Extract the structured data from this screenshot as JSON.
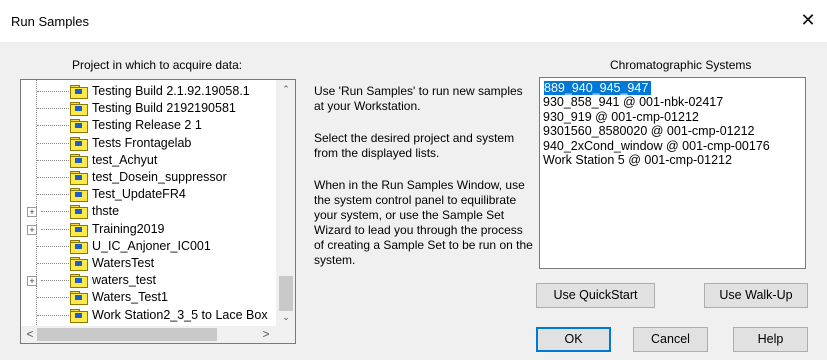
{
  "window": {
    "title": "Run Samples",
    "close_glyph": "✕"
  },
  "project_panel": {
    "label": "Project in which to acquire data:",
    "items": [
      {
        "label": "Testing Build 2.1.92.19058.1",
        "expandable": false
      },
      {
        "label": "Testing Build 2192190581",
        "expandable": false
      },
      {
        "label": "Testing Release 2 1",
        "expandable": false
      },
      {
        "label": "Tests Frontagelab",
        "expandable": false
      },
      {
        "label": "test_Achyut",
        "expandable": false
      },
      {
        "label": "test_Dosein_suppressor",
        "expandable": false
      },
      {
        "label": "Test_UpdateFR4",
        "expandable": false
      },
      {
        "label": "thste",
        "expandable": true
      },
      {
        "label": "Training2019",
        "expandable": true
      },
      {
        "label": "U_IC_Anjoner_IC001",
        "expandable": false
      },
      {
        "label": "WatersTest",
        "expandable": false
      },
      {
        "label": "waters_test",
        "expandable": true
      },
      {
        "label": "Waters_Test1",
        "expandable": false
      },
      {
        "label": "Work Station2_3_5 to Lace Box",
        "expandable": false
      }
    ],
    "expander_glyph": "+",
    "scroll_up_glyph": "⌃",
    "scroll_down_glyph": "⌄",
    "scroll_left_glyph": "<",
    "scroll_right_glyph": ">"
  },
  "instructions": {
    "p1": "Use 'Run Samples' to run new samples at your Workstation.",
    "p2": "Select the desired project and system from the displayed lists.",
    "p3": "When in the Run Samples Window, use the system control panel to equilibrate your system, or use the Sample Set Wizard to lead you through the process of creating a Sample Set to be run on the system."
  },
  "systems_panel": {
    "label": "Chromatographic Systems",
    "items": [
      "889_940_945_947",
      "930_858_941 @ 001-nbk-02417",
      "930_919 @ 001-cmp-01212",
      "9301560_8580020 @ 001-cmp-01212",
      "940_2xCond_window @ 001-cmp-00176",
      "Work Station 5 @ 001-cmp-01212"
    ],
    "selected_index": 0
  },
  "buttons": {
    "quickstart": "Use QuickStart",
    "walkup": "Use Walk-Up",
    "ok": "OK",
    "cancel": "Cancel",
    "help": "Help"
  },
  "colors": {
    "selection": "#0078d7",
    "folder": "#ffe94a"
  }
}
